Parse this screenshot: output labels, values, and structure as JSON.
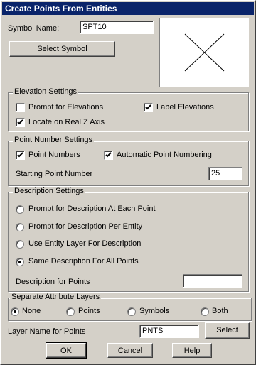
{
  "window": {
    "title": "Create Points From Entities"
  },
  "symbol": {
    "name_label": "Symbol Name:",
    "name_value": "SPT10",
    "select_button": "Select Symbol"
  },
  "elevation": {
    "title": "Elevation Settings",
    "prompt_label": "Prompt for Elevations",
    "prompt_checked": false,
    "label_label": "Label Elevations",
    "label_checked": true,
    "locate_label": "Locate on Real Z Axis",
    "locate_checked": true
  },
  "point_number": {
    "title": "Point Number Settings",
    "numbers_label": "Point Numbers",
    "numbers_checked": true,
    "auto_label": "Automatic Point Numbering",
    "auto_checked": true,
    "start_label": "Starting Point Number",
    "start_value": "25"
  },
  "description": {
    "title": "Description Settings",
    "options": [
      "Prompt for Description At Each Point",
      "Prompt for Description Per Entity",
      "Use Entity Layer For Description",
      "Same Description For All Points"
    ],
    "selected_index": 3,
    "for_points_label": "Description for Points",
    "for_points_value": ""
  },
  "attribute_layers": {
    "title": "Separate Attribute Layers",
    "options": [
      "None",
      "Points",
      "Symbols",
      "Both"
    ],
    "selected_index": 0
  },
  "layer": {
    "label": "Layer Name for Points",
    "value": "PNTS",
    "select_button": "Select"
  },
  "footer": {
    "ok": "OK",
    "cancel": "Cancel",
    "help": "Help"
  }
}
